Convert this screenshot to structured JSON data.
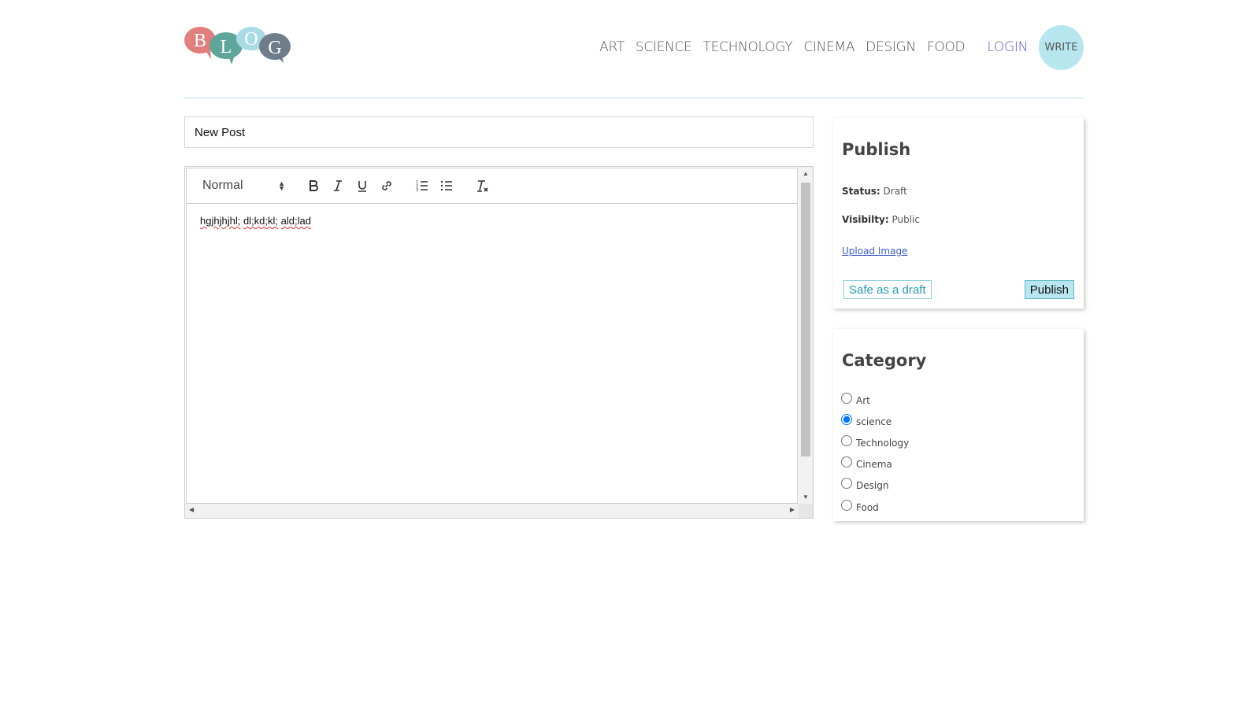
{
  "logo": {
    "letters": [
      "B",
      "L",
      "O",
      "G"
    ]
  },
  "nav": {
    "items": [
      {
        "label": "ART"
      },
      {
        "label": "SCIENCE"
      },
      {
        "label": "TECHNOLOGY"
      },
      {
        "label": "CINEMA"
      },
      {
        "label": "DESIGN"
      },
      {
        "label": "FOOD"
      }
    ],
    "login_label": "LOGIN",
    "write_label": "WRITE"
  },
  "editor": {
    "title_value": "New Post",
    "format_value": "Normal",
    "toolbar_icons": [
      "bold-icon",
      "italic-icon",
      "underline-icon",
      "link-icon",
      "ordered-list-icon",
      "bullet-list-icon",
      "clear-format-icon"
    ],
    "content_words": [
      "hgjhjhjhl;",
      "dl;kd;kl;",
      "ald;lad"
    ]
  },
  "publish": {
    "title": "Publish",
    "status_label": "Status:",
    "status_value": "Draft",
    "visibility_label": "Visibilty:",
    "visibility_value": "Public",
    "upload_label": "Upload Image",
    "draft_button": "Safe as a draft",
    "publish_button": "Publish"
  },
  "category": {
    "title": "Category",
    "selected": "science",
    "options": [
      {
        "label": "Art",
        "value": "art"
      },
      {
        "label": "science",
        "value": "science"
      },
      {
        "label": "Technology",
        "value": "technology"
      },
      {
        "label": "Cinema",
        "value": "cinema"
      },
      {
        "label": "Design",
        "value": "design"
      },
      {
        "label": "Food",
        "value": "food"
      }
    ]
  },
  "colors": {
    "accent": "#b8e6ef",
    "link": "#5a56c8",
    "logo_b": "#e17f7f",
    "logo_l": "#5fa59a",
    "logo_o": "#a9dbe6",
    "logo_g": "#6f7d8a"
  }
}
